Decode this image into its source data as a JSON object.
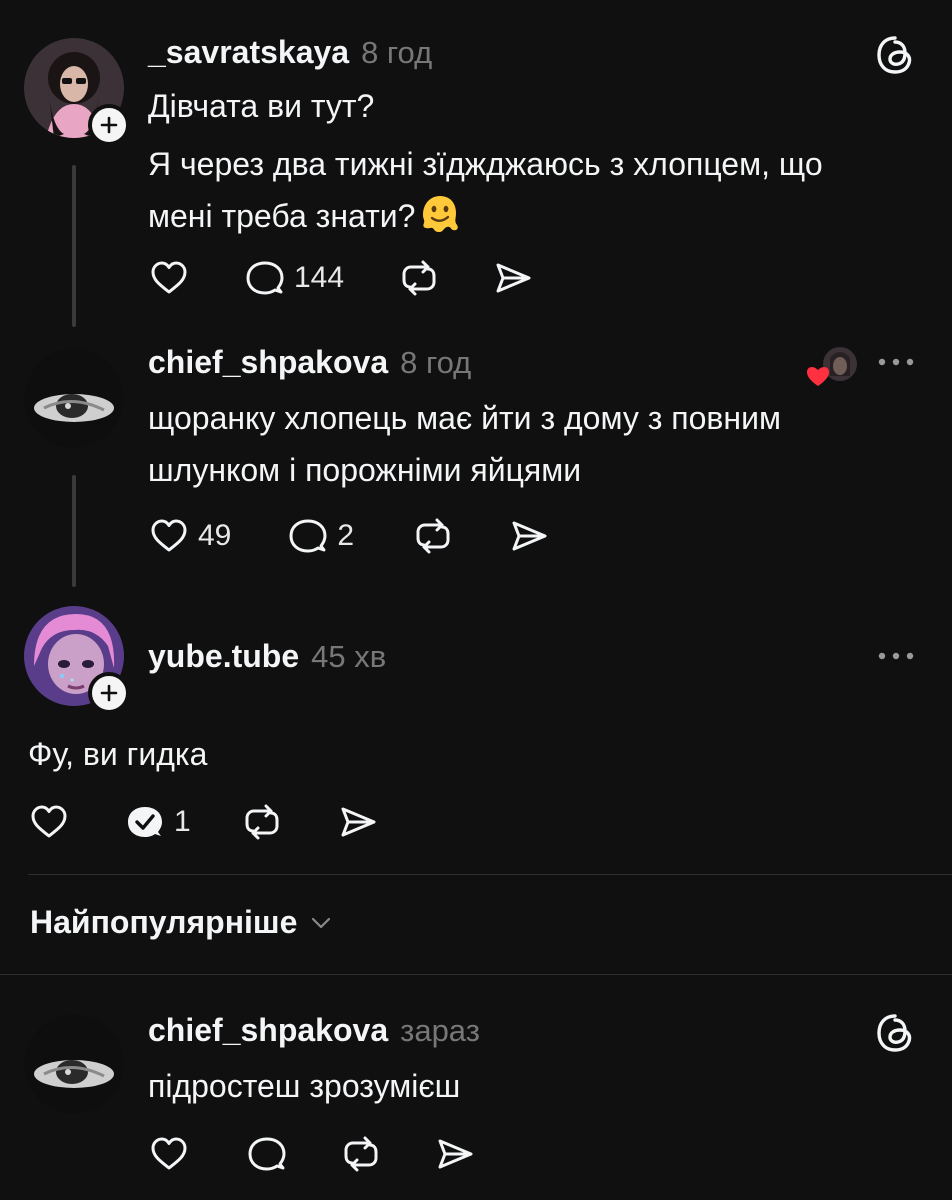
{
  "posts": [
    {
      "username": "_savratskaya",
      "time": "8 год",
      "text_lines": [
        "Дівчата ви тут?",
        "Я через два тижні зїджджаюсь з хлопцем, що",
        "мені треба знати?"
      ],
      "emoji": "melting-face",
      "likes": "",
      "replies": "144"
    },
    {
      "username": "chief_shpakova",
      "time": "8 год",
      "text_lines": [
        "щоранку хлопець має йти з дому з повним",
        "шлунком і порожніми яйцями"
      ],
      "likes": "49",
      "replies": "2"
    },
    {
      "username": "yube.tube",
      "time": "45 хв",
      "text_lines": [
        "Фу, ви гидка"
      ],
      "likes": "",
      "replies": "1"
    },
    {
      "username": "chief_shpakova",
      "time": "зараз",
      "text_lines": [
        "підростеш зрозумієш"
      ],
      "likes": "",
      "replies": ""
    }
  ],
  "sort": {
    "label": "Найпопулярніше"
  },
  "colors": {
    "background": "#101010",
    "text": "#f3f5f7",
    "muted": "#777777",
    "like_heart": "#ff3040"
  },
  "icons": [
    "heart-icon",
    "reply-icon",
    "repost-icon",
    "share-icon",
    "threads-logo-icon",
    "more-icon",
    "plus-icon",
    "chevron-down-icon",
    "replied-check-icon"
  ]
}
